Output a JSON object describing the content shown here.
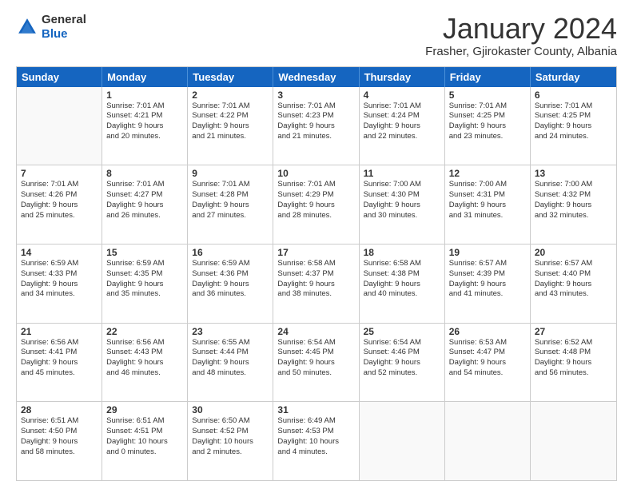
{
  "header": {
    "logo_general": "General",
    "logo_blue": "Blue",
    "month_title": "January 2024",
    "location": "Frasher, Gjirokaster County, Albania"
  },
  "days_of_week": [
    "Sunday",
    "Monday",
    "Tuesday",
    "Wednesday",
    "Thursday",
    "Friday",
    "Saturday"
  ],
  "rows": [
    [
      {
        "day": "",
        "lines": []
      },
      {
        "day": "1",
        "lines": [
          "Sunrise: 7:01 AM",
          "Sunset: 4:21 PM",
          "Daylight: 9 hours",
          "and 20 minutes."
        ]
      },
      {
        "day": "2",
        "lines": [
          "Sunrise: 7:01 AM",
          "Sunset: 4:22 PM",
          "Daylight: 9 hours",
          "and 21 minutes."
        ]
      },
      {
        "day": "3",
        "lines": [
          "Sunrise: 7:01 AM",
          "Sunset: 4:23 PM",
          "Daylight: 9 hours",
          "and 21 minutes."
        ]
      },
      {
        "day": "4",
        "lines": [
          "Sunrise: 7:01 AM",
          "Sunset: 4:24 PM",
          "Daylight: 9 hours",
          "and 22 minutes."
        ]
      },
      {
        "day": "5",
        "lines": [
          "Sunrise: 7:01 AM",
          "Sunset: 4:25 PM",
          "Daylight: 9 hours",
          "and 23 minutes."
        ]
      },
      {
        "day": "6",
        "lines": [
          "Sunrise: 7:01 AM",
          "Sunset: 4:25 PM",
          "Daylight: 9 hours",
          "and 24 minutes."
        ]
      }
    ],
    [
      {
        "day": "7",
        "lines": [
          "Sunrise: 7:01 AM",
          "Sunset: 4:26 PM",
          "Daylight: 9 hours",
          "and 25 minutes."
        ]
      },
      {
        "day": "8",
        "lines": [
          "Sunrise: 7:01 AM",
          "Sunset: 4:27 PM",
          "Daylight: 9 hours",
          "and 26 minutes."
        ]
      },
      {
        "day": "9",
        "lines": [
          "Sunrise: 7:01 AM",
          "Sunset: 4:28 PM",
          "Daylight: 9 hours",
          "and 27 minutes."
        ]
      },
      {
        "day": "10",
        "lines": [
          "Sunrise: 7:01 AM",
          "Sunset: 4:29 PM",
          "Daylight: 9 hours",
          "and 28 minutes."
        ]
      },
      {
        "day": "11",
        "lines": [
          "Sunrise: 7:00 AM",
          "Sunset: 4:30 PM",
          "Daylight: 9 hours",
          "and 30 minutes."
        ]
      },
      {
        "day": "12",
        "lines": [
          "Sunrise: 7:00 AM",
          "Sunset: 4:31 PM",
          "Daylight: 9 hours",
          "and 31 minutes."
        ]
      },
      {
        "day": "13",
        "lines": [
          "Sunrise: 7:00 AM",
          "Sunset: 4:32 PM",
          "Daylight: 9 hours",
          "and 32 minutes."
        ]
      }
    ],
    [
      {
        "day": "14",
        "lines": [
          "Sunrise: 6:59 AM",
          "Sunset: 4:33 PM",
          "Daylight: 9 hours",
          "and 34 minutes."
        ]
      },
      {
        "day": "15",
        "lines": [
          "Sunrise: 6:59 AM",
          "Sunset: 4:35 PM",
          "Daylight: 9 hours",
          "and 35 minutes."
        ]
      },
      {
        "day": "16",
        "lines": [
          "Sunrise: 6:59 AM",
          "Sunset: 4:36 PM",
          "Daylight: 9 hours",
          "and 36 minutes."
        ]
      },
      {
        "day": "17",
        "lines": [
          "Sunrise: 6:58 AM",
          "Sunset: 4:37 PM",
          "Daylight: 9 hours",
          "and 38 minutes."
        ]
      },
      {
        "day": "18",
        "lines": [
          "Sunrise: 6:58 AM",
          "Sunset: 4:38 PM",
          "Daylight: 9 hours",
          "and 40 minutes."
        ]
      },
      {
        "day": "19",
        "lines": [
          "Sunrise: 6:57 AM",
          "Sunset: 4:39 PM",
          "Daylight: 9 hours",
          "and 41 minutes."
        ]
      },
      {
        "day": "20",
        "lines": [
          "Sunrise: 6:57 AM",
          "Sunset: 4:40 PM",
          "Daylight: 9 hours",
          "and 43 minutes."
        ]
      }
    ],
    [
      {
        "day": "21",
        "lines": [
          "Sunrise: 6:56 AM",
          "Sunset: 4:41 PM",
          "Daylight: 9 hours",
          "and 45 minutes."
        ]
      },
      {
        "day": "22",
        "lines": [
          "Sunrise: 6:56 AM",
          "Sunset: 4:43 PM",
          "Daylight: 9 hours",
          "and 46 minutes."
        ]
      },
      {
        "day": "23",
        "lines": [
          "Sunrise: 6:55 AM",
          "Sunset: 4:44 PM",
          "Daylight: 9 hours",
          "and 48 minutes."
        ]
      },
      {
        "day": "24",
        "lines": [
          "Sunrise: 6:54 AM",
          "Sunset: 4:45 PM",
          "Daylight: 9 hours",
          "and 50 minutes."
        ]
      },
      {
        "day": "25",
        "lines": [
          "Sunrise: 6:54 AM",
          "Sunset: 4:46 PM",
          "Daylight: 9 hours",
          "and 52 minutes."
        ]
      },
      {
        "day": "26",
        "lines": [
          "Sunrise: 6:53 AM",
          "Sunset: 4:47 PM",
          "Daylight: 9 hours",
          "and 54 minutes."
        ]
      },
      {
        "day": "27",
        "lines": [
          "Sunrise: 6:52 AM",
          "Sunset: 4:48 PM",
          "Daylight: 9 hours",
          "and 56 minutes."
        ]
      }
    ],
    [
      {
        "day": "28",
        "lines": [
          "Sunrise: 6:51 AM",
          "Sunset: 4:50 PM",
          "Daylight: 9 hours",
          "and 58 minutes."
        ]
      },
      {
        "day": "29",
        "lines": [
          "Sunrise: 6:51 AM",
          "Sunset: 4:51 PM",
          "Daylight: 10 hours",
          "and 0 minutes."
        ]
      },
      {
        "day": "30",
        "lines": [
          "Sunrise: 6:50 AM",
          "Sunset: 4:52 PM",
          "Daylight: 10 hours",
          "and 2 minutes."
        ]
      },
      {
        "day": "31",
        "lines": [
          "Sunrise: 6:49 AM",
          "Sunset: 4:53 PM",
          "Daylight: 10 hours",
          "and 4 minutes."
        ]
      },
      {
        "day": "",
        "lines": []
      },
      {
        "day": "",
        "lines": []
      },
      {
        "day": "",
        "lines": []
      }
    ]
  ]
}
